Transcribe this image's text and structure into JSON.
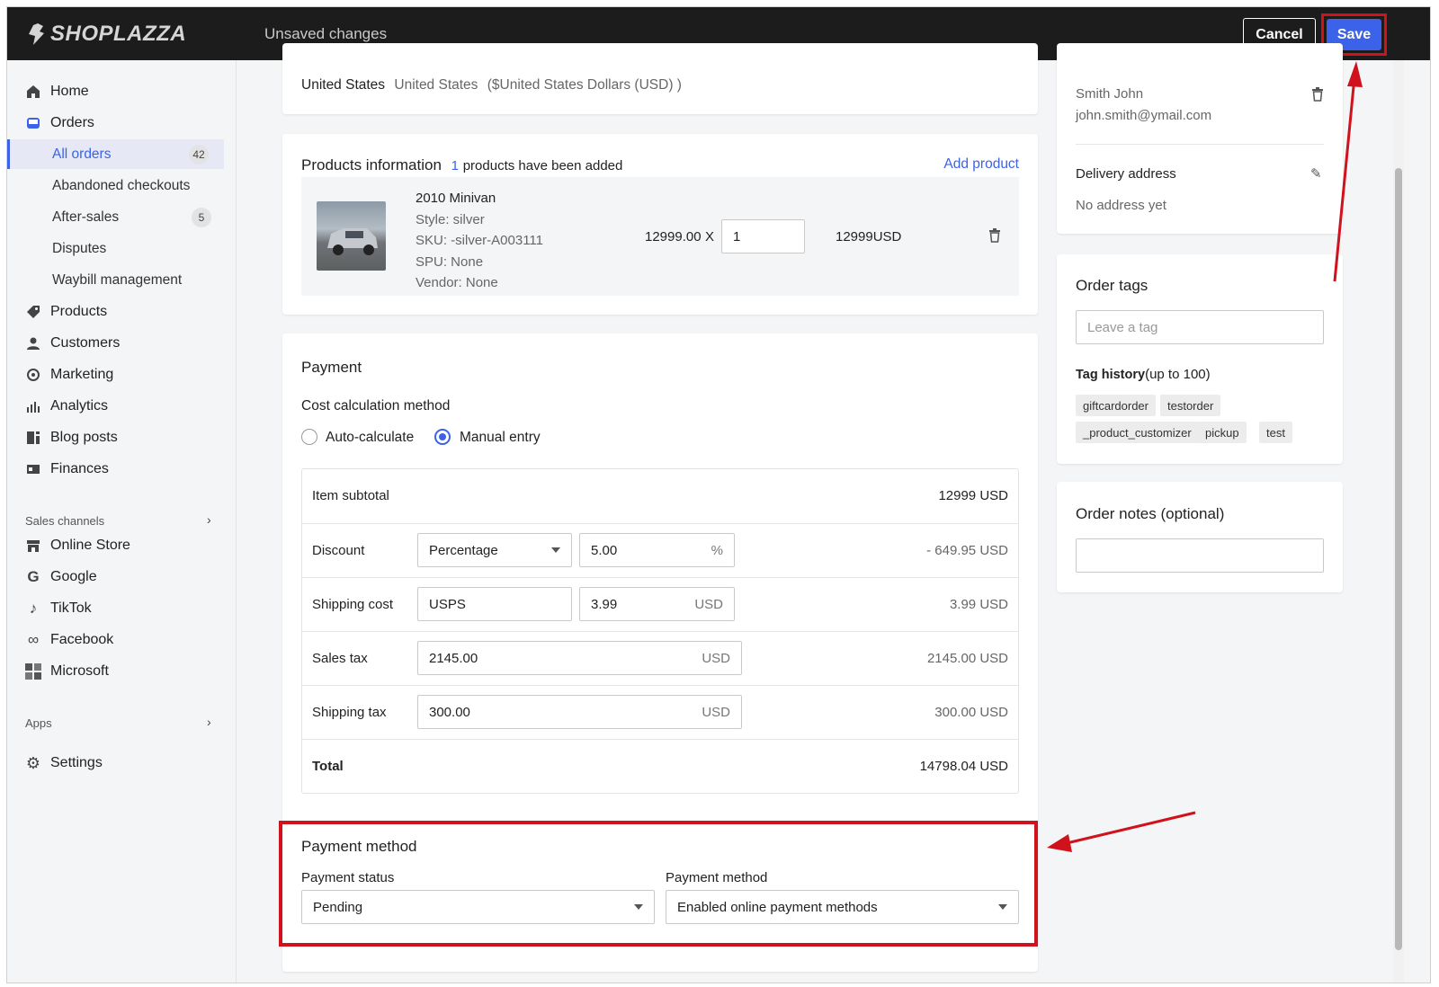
{
  "topbar": {
    "logo": "SHOPLAZZA",
    "status": "Unsaved changes",
    "cancel_label": "Cancel",
    "save_label": "Save"
  },
  "sidebar": {
    "items": [
      {
        "label": "Home",
        "icon": "home-icon"
      },
      {
        "label": "Orders",
        "icon": "orders-icon"
      },
      {
        "label": "Products",
        "icon": "tag-icon"
      },
      {
        "label": "Customers",
        "icon": "person-icon"
      },
      {
        "label": "Marketing",
        "icon": "marketing-icon"
      },
      {
        "label": "Analytics",
        "icon": "bar-chart-icon"
      },
      {
        "label": "Blog posts",
        "icon": "blog-icon"
      },
      {
        "label": "Finances",
        "icon": "finances-icon"
      }
    ],
    "order_subitems": [
      {
        "label": "All orders",
        "count": "42"
      },
      {
        "label": "Abandoned checkouts"
      },
      {
        "label": "After-sales",
        "count": "5"
      },
      {
        "label": "Disputes"
      },
      {
        "label": "Waybill management"
      }
    ],
    "sales_channels_label": "Sales channels",
    "channels": [
      {
        "label": "Online Store",
        "icon": "store-icon"
      },
      {
        "label": "Google",
        "icon": "google-icon"
      },
      {
        "label": "TikTok",
        "icon": "tiktok-icon"
      },
      {
        "label": "Facebook",
        "icon": "meta-icon"
      },
      {
        "label": "Microsoft",
        "icon": "microsoft-icon"
      }
    ],
    "apps_label": "Apps",
    "settings_label": "Settings"
  },
  "market": {
    "name": "United States",
    "detail": "United States",
    "currency": "($United States Dollars (USD) )"
  },
  "products": {
    "title": "Products information",
    "count": "1",
    "count_suffix": "products have been added",
    "add_label": "Add product",
    "item": {
      "name": "2010 Minivan",
      "style": "Style: silver",
      "sku": "SKU: -silver-A003111",
      "spu": "SPU: None",
      "vendor": "Vendor: None",
      "price": "12999.00",
      "times": "X",
      "quantity": "1",
      "total": "12999USD"
    }
  },
  "payment": {
    "title": "Payment",
    "method_label": "Cost calculation method",
    "options": [
      "Auto-calculate",
      "Manual entry"
    ],
    "selected_option": "Manual entry",
    "rows": {
      "subtotal_label": "Item subtotal",
      "subtotal_value": "12999 USD",
      "discount_label": "Discount",
      "discount_type": "Percentage",
      "discount_amount": "5.00",
      "discount_unit": "%",
      "discount_value": "- 649.95 USD",
      "shipping_label": "Shipping cost",
      "shipping_carrier": "USPS",
      "shipping_amount": "3.99",
      "shipping_unit": "USD",
      "shipping_value": "3.99 USD",
      "tax_label": "Sales tax",
      "tax_amount": "2145.00",
      "tax_unit": "USD",
      "tax_value": "2145.00 USD",
      "shipping_tax_label": "Shipping tax",
      "shipping_tax_amount": "300.00",
      "shipping_tax_unit": "USD",
      "shipping_tax_value": "300.00 USD",
      "total_label": "Total",
      "total_value": "14798.04 USD"
    }
  },
  "payment_method": {
    "title": "Payment method",
    "status_label": "Payment status",
    "status_value": "Pending",
    "method_label": "Payment method",
    "method_value": "Enabled online payment methods"
  },
  "customer": {
    "name": "Smith John",
    "email": "john.smith@ymail.com",
    "delivery_label": "Delivery address",
    "delivery_value": "No address yet"
  },
  "order_tags": {
    "title": "Order tags",
    "placeholder": "Leave a tag",
    "history_label": "Tag history",
    "history_note": "(up to 100)",
    "tags": [
      "giftcardorder",
      "testorder",
      "_product_customizer",
      "pickup",
      "test"
    ]
  },
  "order_notes": {
    "title": "Order notes (optional)"
  },
  "colors": {
    "accent": "#3b62e8",
    "highlight": "#d0121c",
    "topbar": "#1c1c1c"
  }
}
